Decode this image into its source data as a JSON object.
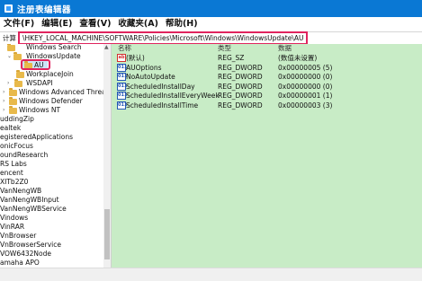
{
  "window": {
    "title": "注册表编辑器",
    "icon": "registry-icon"
  },
  "menu": [
    "文件(F)",
    "编辑(E)",
    "查看(V)",
    "收藏夹(A)",
    "帮助(H)"
  ],
  "address": {
    "label": "计算",
    "path": "\\HKEY_LOCAL_MACHINE\\SOFTWARE\\Policies\\Microsoft\\Windows\\WindowsUpdate\\AU"
  },
  "tree": [
    {
      "label": "Windows Search",
      "arrow": "",
      "folder": true
    },
    {
      "label": "WindowsUpdate",
      "arrow": "⌄",
      "folder": true
    },
    {
      "label": "AU",
      "arrow": "",
      "folder": true,
      "selected": true
    },
    {
      "label": "WorkplaceJoin",
      "arrow": "",
      "folder": true
    },
    {
      "label": "WSDAPI",
      "arrow": "›",
      "folder": true
    },
    {
      "label": "Windows Advanced Threat P",
      "arrow": "›",
      "folder": true
    },
    {
      "label": "Windows Defender",
      "arrow": "›",
      "folder": true
    },
    {
      "label": "Windows NT",
      "arrow": "›",
      "folder": true
    },
    {
      "label": "uddingZip",
      "arrow": "",
      "folder": false
    },
    {
      "label": "ealtek",
      "arrow": "",
      "folder": false
    },
    {
      "label": "egisteredApplications",
      "arrow": "",
      "folder": false
    },
    {
      "label": "onicFocus",
      "arrow": "",
      "folder": false
    },
    {
      "label": "oundResearch",
      "arrow": "",
      "folder": false
    },
    {
      "label": "RS Labs",
      "arrow": "",
      "folder": false
    },
    {
      "label": "encent",
      "arrow": "",
      "folder": false
    },
    {
      "label": "XITb2Z0",
      "arrow": "",
      "folder": false
    },
    {
      "label": "VanNengWB",
      "arrow": "",
      "folder": false
    },
    {
      "label": "VanNengWBInput",
      "arrow": "",
      "folder": false
    },
    {
      "label": "VanNengWBService",
      "arrow": "",
      "folder": false
    },
    {
      "label": "Vindows",
      "arrow": "",
      "folder": false
    },
    {
      "label": "VinRAR",
      "arrow": "",
      "folder": false
    },
    {
      "label": "VnBrowser",
      "arrow": "",
      "folder": false
    },
    {
      "label": "VnBrowserService",
      "arrow": "",
      "folder": false
    },
    {
      "label": "VOW6432Node",
      "arrow": "",
      "folder": false
    },
    {
      "label": "amaha APO",
      "arrow": "",
      "folder": false
    }
  ],
  "list_headers": {
    "name": "名称",
    "type": "类型",
    "data": "数据"
  },
  "values": [
    {
      "icon": "sz",
      "icon_text": "ab",
      "name": "(默认)",
      "type": "REG_SZ",
      "data": "(数值未设置)"
    },
    {
      "icon": "dw",
      "icon_text": "011",
      "name": "AUOptions",
      "type": "REG_DWORD",
      "data": "0x00000005 (5)"
    },
    {
      "icon": "dw",
      "icon_text": "011",
      "name": "NoAutoUpdate",
      "type": "REG_DWORD",
      "data": "0x00000000 (0)"
    },
    {
      "icon": "dw",
      "icon_text": "011",
      "name": "ScheduledInstallDay",
      "type": "REG_DWORD",
      "data": "0x00000000 (0)"
    },
    {
      "icon": "dw",
      "icon_text": "011",
      "name": "ScheduledInstallEveryWeek",
      "type": "REG_DWORD",
      "data": "0x00000001 (1)"
    },
    {
      "icon": "dw",
      "icon_text": "011",
      "name": "ScheduledInstallTime",
      "type": "REG_DWORD",
      "data": "0x00000003 (3)"
    }
  ],
  "colors": {
    "titlebar": "#0a78d4",
    "list_bg": "#c8ecc6",
    "highlight_box": "#e0245e",
    "selection": "#cce4f7"
  }
}
